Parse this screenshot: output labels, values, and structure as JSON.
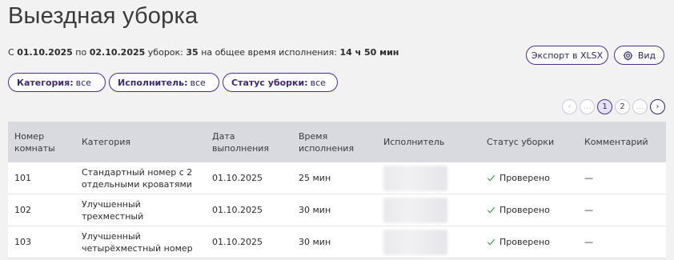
{
  "title": "Выездная уборка",
  "summary": {
    "p1": "С ",
    "date_from": "01.10.2025",
    "p2": " по ",
    "date_to": "02.10.2025",
    "p3": " уборок: ",
    "count": "35",
    "p4": " на общее время исполнения: ",
    "total_time": "14 ч 50 мин"
  },
  "actions": {
    "export_label": "Экспорт в XLSX",
    "view_label": "Вид"
  },
  "filters": [
    {
      "label": "Категория:",
      "value": "все"
    },
    {
      "label": "Исполнитель:",
      "value": "все"
    },
    {
      "label": "Статус уборки:",
      "value": "все"
    }
  ],
  "pagination": {
    "prev": "‹",
    "ellipsis_before": "...",
    "pages": [
      "1",
      "2"
    ],
    "current": "1",
    "ellipsis_after": "...",
    "next": "›"
  },
  "table": {
    "headers": [
      "Номер комнаты",
      "Категория",
      "Дата выполнения",
      "Время исполнения",
      "Исполнитель",
      "Статус уборки",
      "Комментарий"
    ],
    "rows": [
      {
        "room": "101",
        "category": "Стандартный номер с 2 отдельными кроватями",
        "date": "01.10.2025",
        "time": "25 мин",
        "status": "Проверено",
        "comment": "—"
      },
      {
        "room": "102",
        "category": "Улучшенный трехместный",
        "date": "01.10.2025",
        "time": "30 мин",
        "status": "Проверено",
        "comment": "—"
      },
      {
        "room": "103",
        "category": "Улучшенный четырёхместный номер",
        "date": "01.10.2025",
        "time": "30 мин",
        "status": "Проверено",
        "comment": "—"
      }
    ]
  },
  "colors": {
    "accent": "#4a2e8a",
    "check": "#3aa14a",
    "header_bg": "#d9dae0",
    "page_bg": "#f3f2f2"
  },
  "icons": {
    "view": "gear-icon",
    "filter": "chevron-down-icon",
    "status": "check-icon"
  }
}
